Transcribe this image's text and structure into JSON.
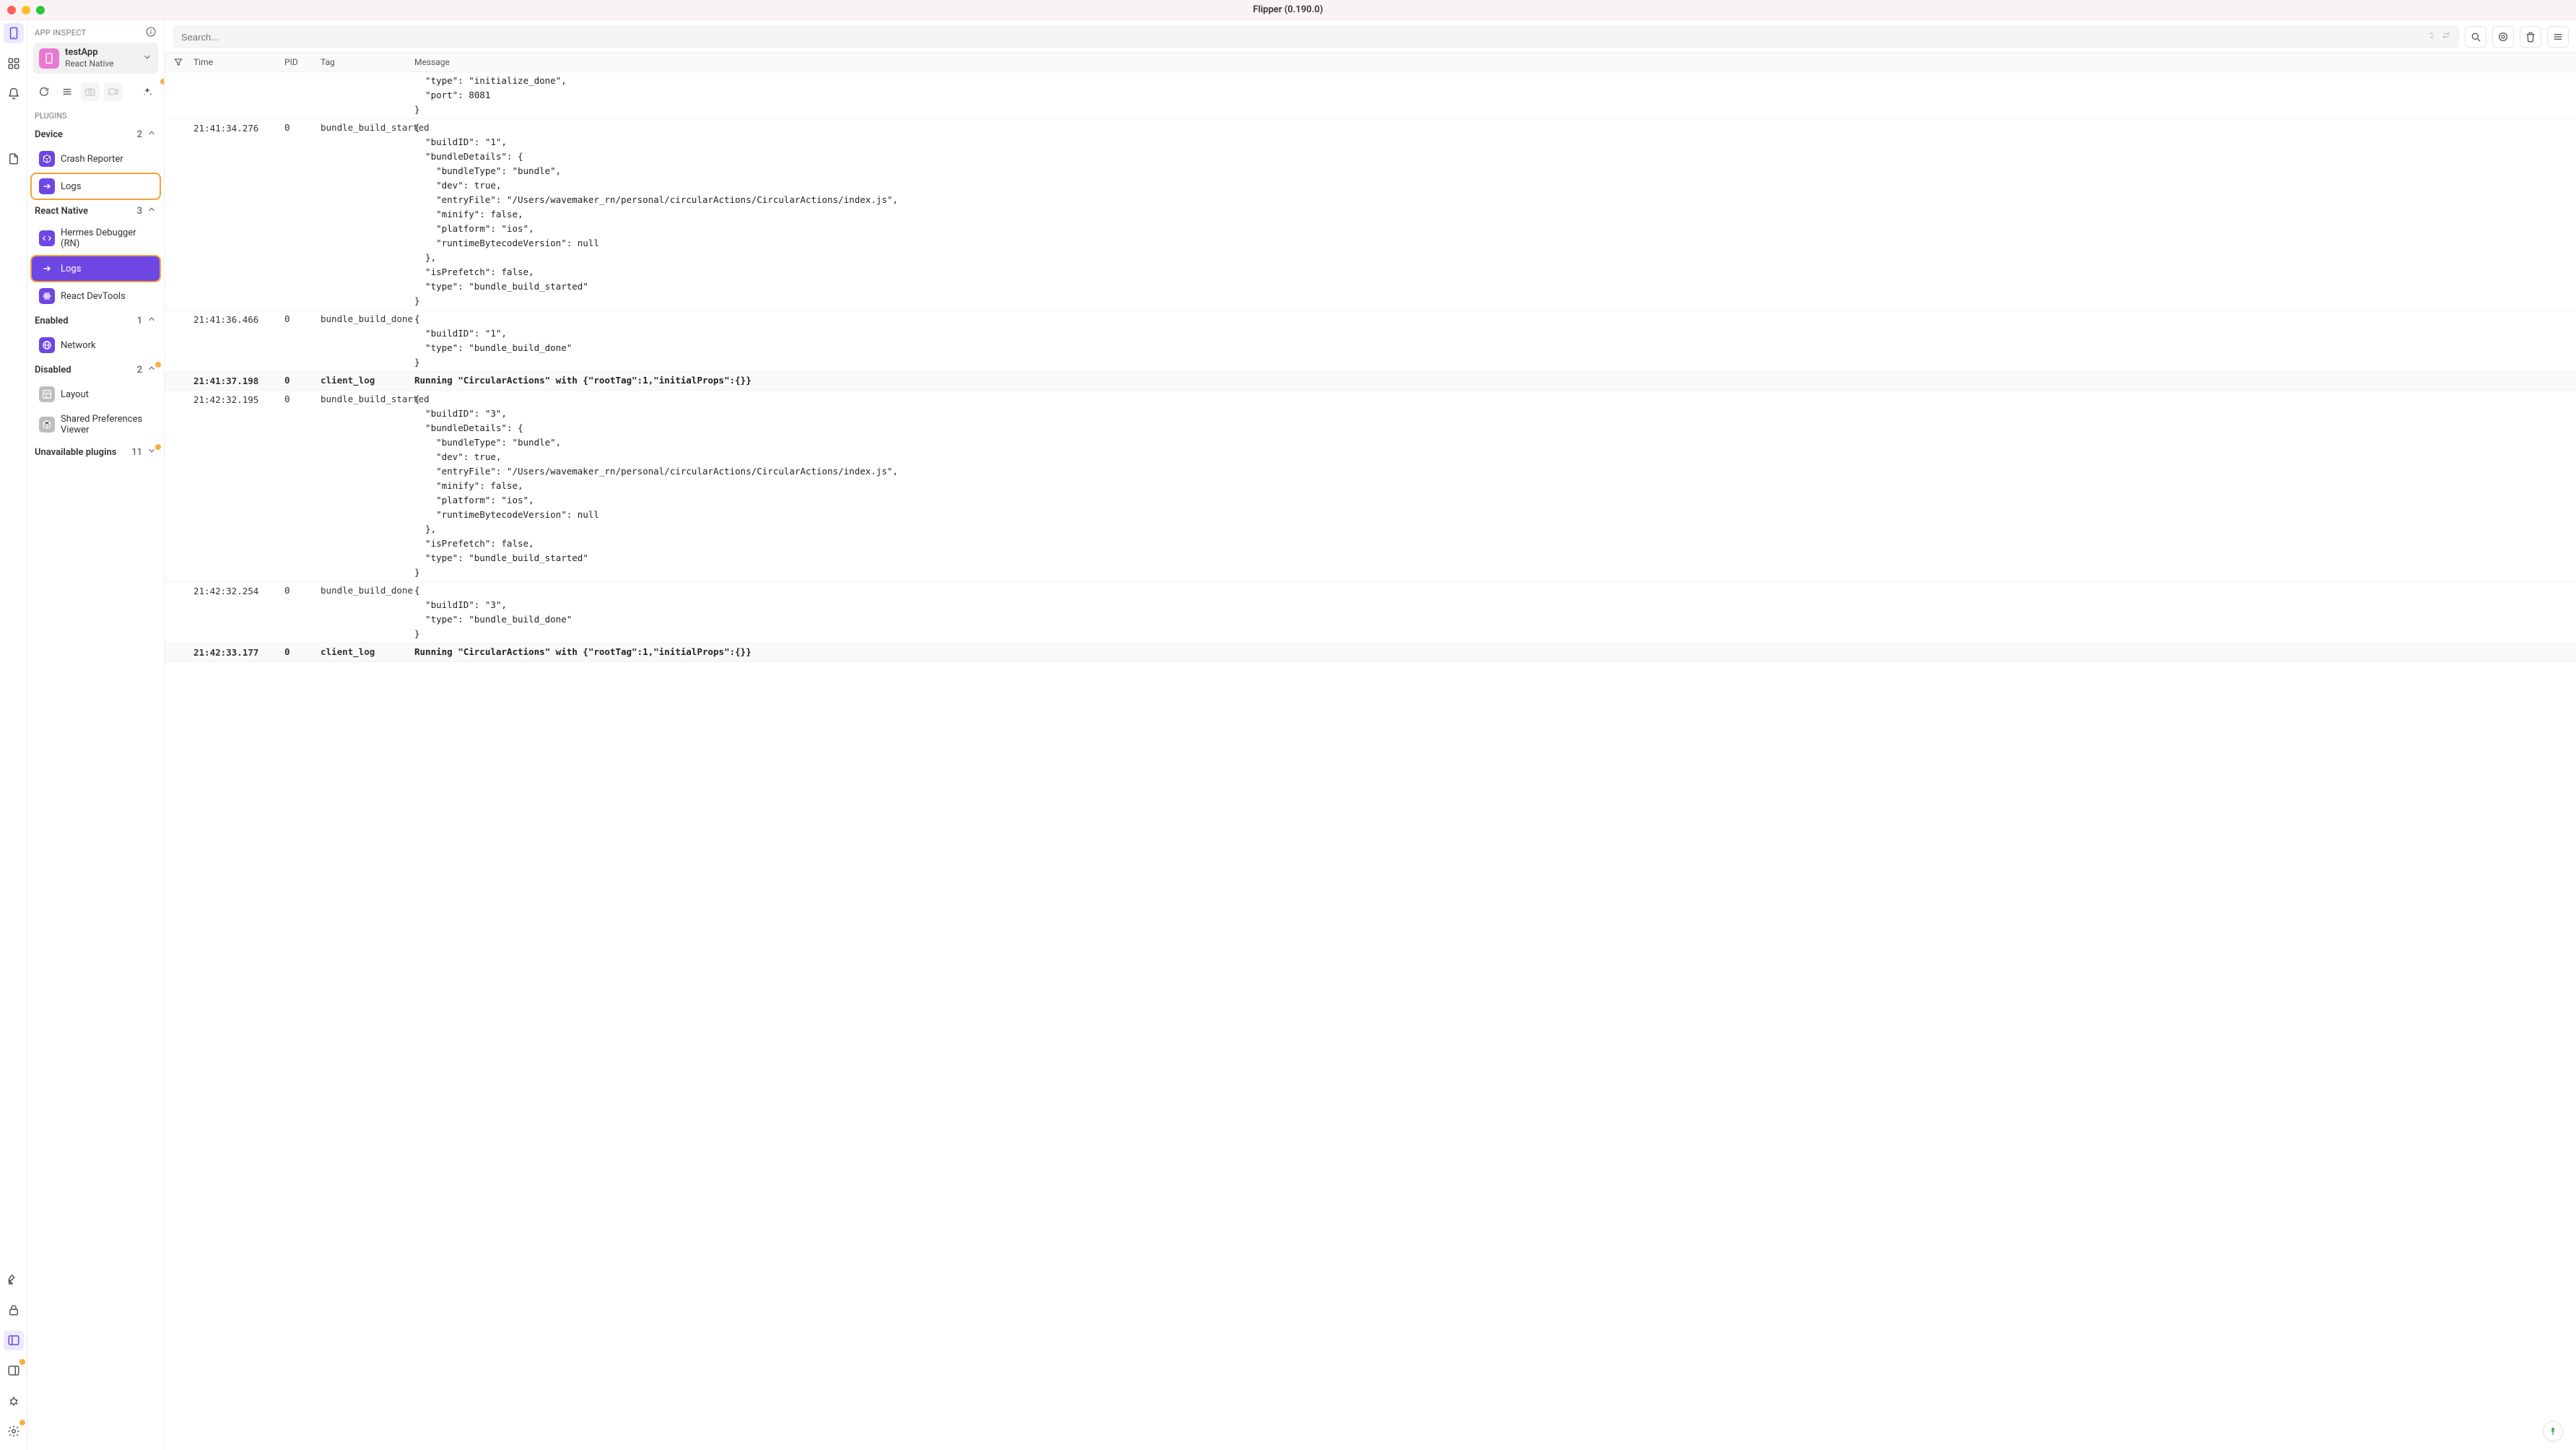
{
  "window_title": "Flipper (0.190.0)",
  "sidebar": {
    "header": "APP INSPECT",
    "app": {
      "name": "testApp",
      "platform": "React Native"
    },
    "plugins_label": "PLUGINS",
    "sections": {
      "device": {
        "title": "Device",
        "count": "2",
        "items": [
          {
            "icon": "box",
            "label": "Crash Reporter",
            "selected": false,
            "highlight": false
          },
          {
            "icon": "arrow",
            "label": "Logs",
            "selected": false,
            "highlight": true
          }
        ]
      },
      "react_native": {
        "title": "React Native",
        "count": "3",
        "items": [
          {
            "icon": "code",
            "label": "Hermes Debugger (RN)",
            "selected": false,
            "highlight": false
          },
          {
            "icon": "arrow",
            "label": "Logs",
            "selected": true,
            "highlight": true
          },
          {
            "icon": "atom",
            "label": "React DevTools",
            "selected": false,
            "highlight": false
          }
        ]
      },
      "enabled": {
        "title": "Enabled",
        "count": "1",
        "items": [
          {
            "icon": "globe",
            "label": "Network",
            "selected": false,
            "highlight": false
          }
        ]
      },
      "disabled": {
        "title": "Disabled",
        "count": "2",
        "items": [
          {
            "icon": "layout",
            "label": "Layout",
            "selected": false,
            "highlight": false,
            "muted": true
          },
          {
            "icon": "box",
            "label": "Shared Preferences Viewer",
            "selected": false,
            "highlight": false,
            "muted": true
          }
        ]
      },
      "unavailable": {
        "title": "Unavailable plugins",
        "count": "11"
      }
    }
  },
  "toolbar": {
    "search_placeholder": "Search..."
  },
  "columns": {
    "time": "Time",
    "pid": "PID",
    "tag": "Tag",
    "message": "Message"
  },
  "logs": [
    {
      "time": "",
      "pid": "",
      "tag": "",
      "bold": false,
      "message": "  \"type\": \"initialize_done\",\n  \"port\": 8081\n}"
    },
    {
      "time": "21:41:34.276",
      "pid": "0",
      "tag": "bundle_build_started",
      "bold": false,
      "message": "{\n  \"buildID\": \"1\",\n  \"bundleDetails\": {\n    \"bundleType\": \"bundle\",\n    \"dev\": true,\n    \"entryFile\": \"/Users/wavemaker_rn/personal/circularActions/CircularActions/index.js\",\n    \"minify\": false,\n    \"platform\": \"ios\",\n    \"runtimeBytecodeVersion\": null\n  },\n  \"isPrefetch\": false,\n  \"type\": \"bundle_build_started\"\n}"
    },
    {
      "time": "21:41:36.466",
      "pid": "0",
      "tag": "bundle_build_done",
      "bold": false,
      "message": "{\n  \"buildID\": \"1\",\n  \"type\": \"bundle_build_done\"\n}"
    },
    {
      "time": "21:41:37.198",
      "pid": "0",
      "tag": "client_log",
      "bold": true,
      "message": "Running \"CircularActions\" with {\"rootTag\":1,\"initialProps\":{}}"
    },
    {
      "time": "21:42:32.195",
      "pid": "0",
      "tag": "bundle_build_started",
      "bold": false,
      "message": "{\n  \"buildID\": \"3\",\n  \"bundleDetails\": {\n    \"bundleType\": \"bundle\",\n    \"dev\": true,\n    \"entryFile\": \"/Users/wavemaker_rn/personal/circularActions/CircularActions/index.js\",\n    \"minify\": false,\n    \"platform\": \"ios\",\n    \"runtimeBytecodeVersion\": null\n  },\n  \"isPrefetch\": false,\n  \"type\": \"bundle_build_started\"\n}"
    },
    {
      "time": "21:42:32.254",
      "pid": "0",
      "tag": "bundle_build_done",
      "bold": false,
      "message": "{\n  \"buildID\": \"3\",\n  \"type\": \"bundle_build_done\"\n}"
    },
    {
      "time": "21:42:33.177",
      "pid": "0",
      "tag": "client_log",
      "bold": true,
      "message": "Running \"CircularActions\" with {\"rootTag\":1,\"initialProps\":{}}"
    }
  ]
}
